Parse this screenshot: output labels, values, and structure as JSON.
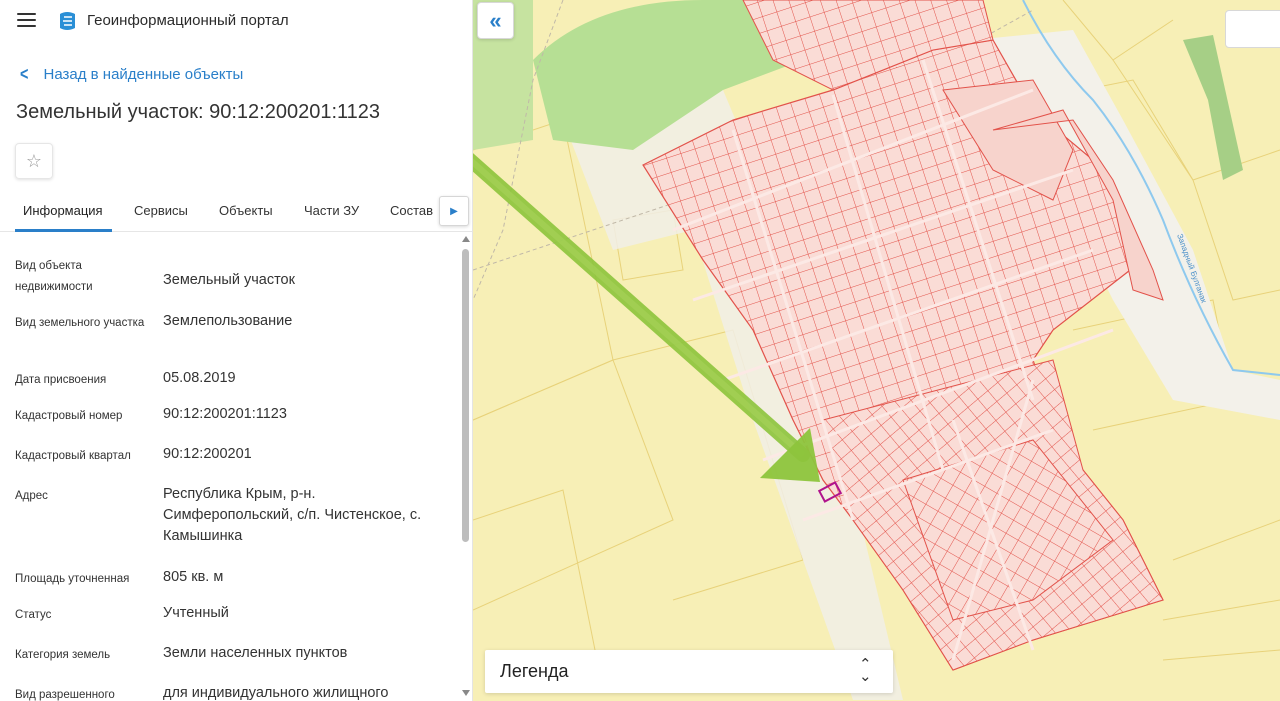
{
  "app": {
    "title": "Геоинформационный портал"
  },
  "nav": {
    "back_label": "Назад в найденные объекты"
  },
  "object": {
    "title": "Земельный участок: 90:12:200201:1123"
  },
  "tabs": [
    {
      "label": "Информация",
      "active": true
    },
    {
      "label": "Сервисы",
      "active": false
    },
    {
      "label": "Объекты",
      "active": false
    },
    {
      "label": "Части ЗУ",
      "active": false
    },
    {
      "label": "Состав",
      "active": false
    }
  ],
  "info": [
    {
      "label": "Вид объекта недвижимости",
      "value": "Земельный участок"
    },
    {
      "label": "Вид земельного участка",
      "value": "Землепользование"
    },
    {
      "label": "Дата присвоения",
      "value": "05.08.2019"
    },
    {
      "label": "Кадастровый номер",
      "value": "90:12:200201:1123"
    },
    {
      "label": "Кадастровый квартал",
      "value": "90:12:200201"
    },
    {
      "label": "Адрес",
      "value": "Республика Крым, р-н. Симферопольский, с/п. Чистенское, с. Камышинка"
    },
    {
      "label": "Площадь уточненная",
      "value": "805 кв. м"
    },
    {
      "label": "Статус",
      "value": "Учтенный"
    },
    {
      "label": "Категория земель",
      "value": "Земли населенных пунктов"
    },
    {
      "label": "Вид разрешенного",
      "value": "для индивидуального жилищного"
    }
  ],
  "map": {
    "legend_label": "Легенда",
    "stream_label": "Западный Булганак",
    "colors": {
      "base": "#f7efb6",
      "forest": "#b6df94",
      "parcel_fill": "#fadcd6",
      "parcel_line": "#e2524a",
      "selected": "#b0148c",
      "arrow": "#8dc43c",
      "water": "#8ec9ee",
      "accent": "#2a7fc9"
    }
  }
}
